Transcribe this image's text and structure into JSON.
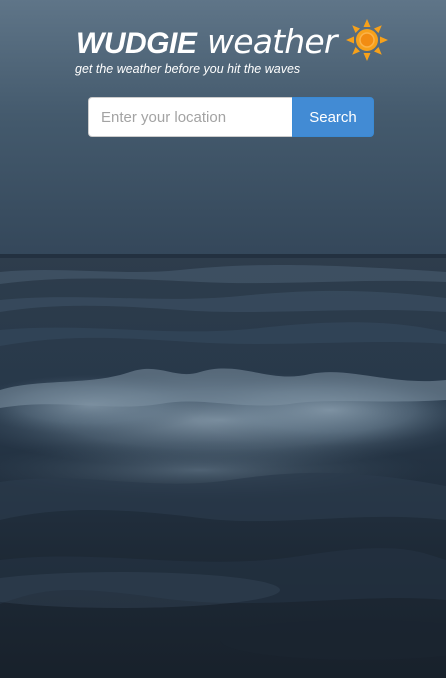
{
  "brand": {
    "name_bold": "WUDGIE",
    "name_light": "weather",
    "tagline": "get the weather before you hit the waves",
    "sun_icon": "sun-icon",
    "sun_color": "#f7a11a"
  },
  "search": {
    "placeholder": "Enter your location",
    "value": "",
    "button_label": "Search",
    "button_color": "#428bd4"
  },
  "background": {
    "description_icon": "ocean-waves-photo",
    "sky_color": "#5d7387",
    "sea_color": "#1f2a36"
  }
}
